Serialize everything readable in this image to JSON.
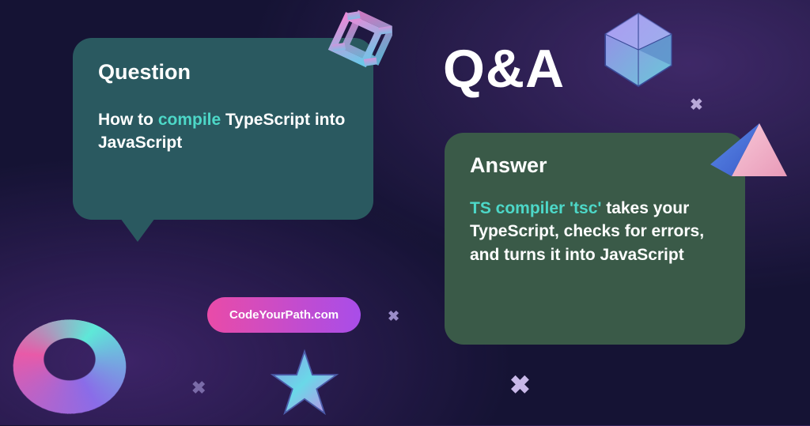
{
  "qa_heading": "Q&A",
  "question": {
    "title": "Question",
    "body_prefix": "How to ",
    "body_highlight": "compile",
    "body_suffix": " TypeScript into JavaScript"
  },
  "answer": {
    "title": "Answer",
    "body_highlight": "TS compiler 'tsc'",
    "body_suffix": " takes your TypeScript, checks for errors, and turns it into JavaScript"
  },
  "badge": {
    "label": "CodeYourPath.com"
  },
  "x_marks": {
    "a": "✖",
    "b": "✖",
    "c": "✖",
    "d": "✖"
  }
}
